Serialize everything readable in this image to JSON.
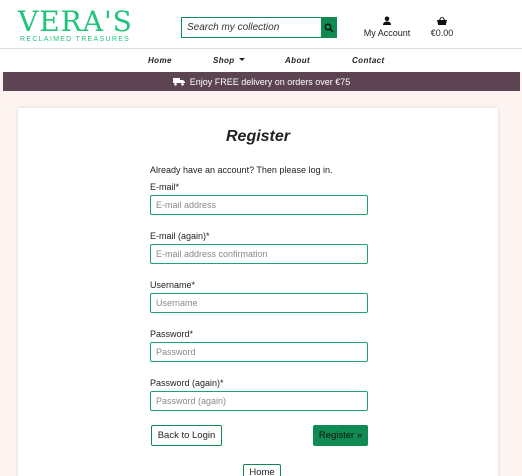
{
  "brand": {
    "name": "VERA'S",
    "tagline": "RECLAIMED TREASURES"
  },
  "search": {
    "placeholder": "Search my collection",
    "icon": "search-icon"
  },
  "header": {
    "account_label": "My Account",
    "account_icon": "user-icon",
    "cart_total": "€0.00",
    "cart_icon": "basket-icon"
  },
  "nav": {
    "items": [
      {
        "label": "Home"
      },
      {
        "label": "Shop"
      },
      {
        "label": "About"
      },
      {
        "label": "Contact"
      }
    ]
  },
  "banner": {
    "text": "Enjoy FREE delivery on orders over €75",
    "icon": "truck-icon"
  },
  "form": {
    "title": "Register",
    "intro_text": "Already have an account? Then please ",
    "login_link": "log in",
    "intro_end": ".",
    "fields": [
      {
        "label": "E-mail",
        "placeholder": "E-mail address"
      },
      {
        "label": "E-mail (again)",
        "placeholder": "E-mail address confirmation"
      },
      {
        "label": "Username",
        "placeholder": "Username"
      },
      {
        "label": "Password",
        "placeholder": "Password"
      },
      {
        "label": "Password (again)",
        "placeholder": "Password (again)"
      }
    ],
    "required_mark": "*",
    "back_button": "Back to Login",
    "submit_button": "Register »",
    "home_button": "Home"
  },
  "colors": {
    "brand_green": "#1fc37a",
    "button_green": "#0f8a53",
    "banner_bg": "#5d4452",
    "page_bg": "#fdf4f1"
  }
}
